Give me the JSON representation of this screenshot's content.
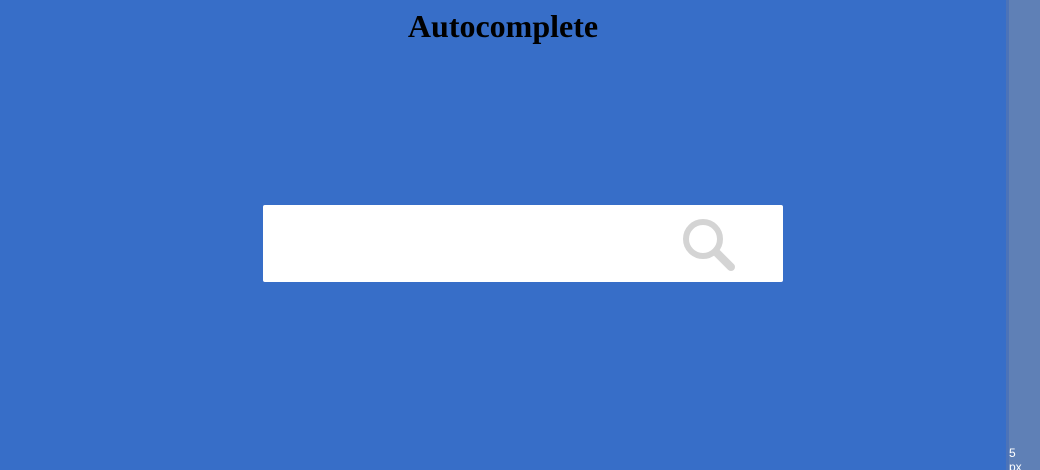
{
  "page": {
    "title": "Autocomplete",
    "background_color": "#376ec8"
  },
  "search": {
    "value": "",
    "placeholder": "",
    "icon": "search-icon",
    "icon_color": "#d4d4d4"
  },
  "scrollbar": {
    "corner_text": "5",
    "corner_text_2": "px"
  }
}
